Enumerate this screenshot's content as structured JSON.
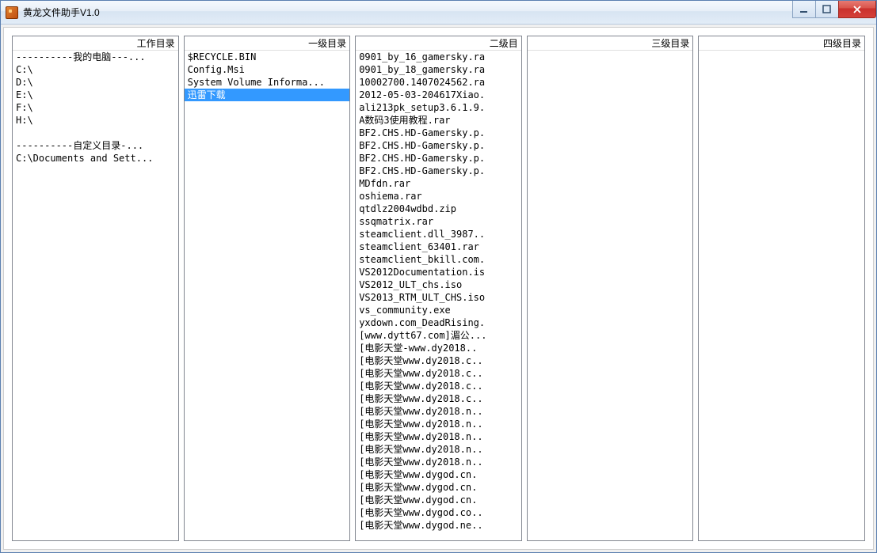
{
  "window": {
    "title": "黄龙文件助手V1.0"
  },
  "columns": {
    "work": {
      "header": "工作目录",
      "section1_label": "----------我的电脑---...",
      "drives": [
        "C:\\",
        "D:\\",
        "E:\\",
        "F:\\",
        "H:\\"
      ],
      "section2_label": "----------自定义目录-...",
      "custom": [
        "C:\\Documents and Sett..."
      ]
    },
    "level1": {
      "header": "一级目录",
      "items": [
        {
          "label": "$RECYCLE.BIN",
          "selected": false
        },
        {
          "label": "Config.Msi",
          "selected": false
        },
        {
          "label": "System Volume Informa...",
          "selected": false
        },
        {
          "label": "迅雷下载",
          "selected": true
        }
      ]
    },
    "level2": {
      "header": "二级目",
      "items": [
        "0901_by_16_gamersky.ra",
        "0901_by_18_gamersky.ra",
        "10002700.1407024562.ra",
        "2012-05-03-204617Xiao.",
        "ali213pk_setup3.6.1.9.",
        "A数码3使用教程.rar",
        "BF2.CHS.HD-Gamersky.p.",
        "BF2.CHS.HD-Gamersky.p.",
        "BF2.CHS.HD-Gamersky.p.",
        "BF2.CHS.HD-Gamersky.p.",
        "MDfdn.rar",
        "oshiema.rar",
        "qtdlz2004wdbd.zip",
        "ssqmatrix.rar",
        "steamclient.dll_3987..",
        "steamclient_63401.rar",
        "steamclient_bkill.com.",
        "VS2012Documentation.is",
        "VS2012_ULT_chs.iso",
        "VS2013_RTM_ULT_CHS.iso",
        "vs_community.exe",
        "yxdown.com_DeadRising.",
        "[www.dytt67.com]湄公...",
        "[电影天堂-www.dy2018..",
        "[电影天堂www.dy2018.c..",
        "[电影天堂www.dy2018.c..",
        "[电影天堂www.dy2018.c..",
        "[电影天堂www.dy2018.c..",
        "[电影天堂www.dy2018.n..",
        "[电影天堂www.dy2018.n..",
        "[电影天堂www.dy2018.n..",
        "[电影天堂www.dy2018.n..",
        "[电影天堂www.dy2018.n..",
        "[电影天堂www.dygod.cn.",
        "[电影天堂www.dygod.cn.",
        "[电影天堂www.dygod.cn.",
        "[电影天堂www.dygod.co..",
        "[电影天堂www.dygod.ne.."
      ]
    },
    "level3": {
      "header": "三级目录",
      "items": []
    },
    "level4": {
      "header": "四级目录",
      "items": []
    }
  }
}
